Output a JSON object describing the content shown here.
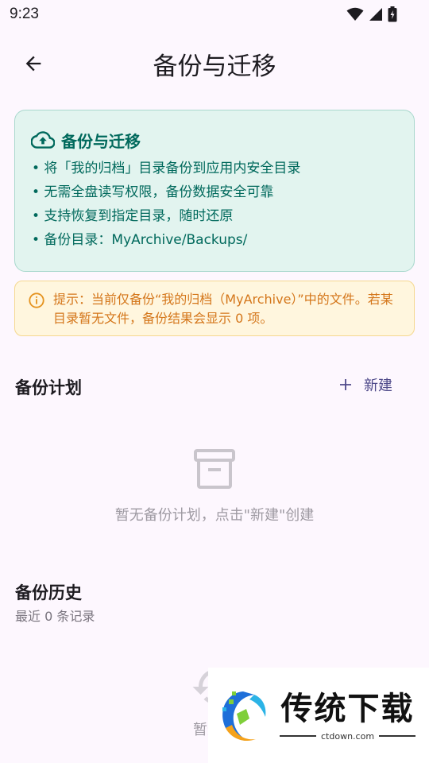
{
  "status_bar": {
    "time": "9:23"
  },
  "app_bar": {
    "title": "备份与迁移"
  },
  "info_card": {
    "title": "备份与迁移",
    "lines": [
      "• 将「我的归档」目录备份到应用内安全目录",
      "• 无需全盘读写权限，备份数据安全可靠",
      "• 支持恢复到指定目录，随时还原",
      "• 备份目录：MyArchive/Backups/"
    ]
  },
  "warning": {
    "text": "提示：当前仅备份“我的归档（MyArchive）”中的文件。若某目录暂无文件，备份结果会显示 0 项。"
  },
  "plans": {
    "title": "备份计划",
    "new_label": "新建",
    "empty_text": "暂无备份计划，点击\"新建\"创建"
  },
  "history": {
    "title": "备份历史",
    "subtitle": "最近 0 条记录",
    "empty_text_partial": "暂无备"
  },
  "watermark": {
    "title": "传统下载",
    "url": "ctdown.com"
  },
  "colors": {
    "background": "#fdf7fe",
    "info_card_bg": "#e2f4ef",
    "info_accent": "#00695c",
    "warning_bg": "#fff6de",
    "warning_text": "#d4761a",
    "primary": "#4f4a8a"
  }
}
